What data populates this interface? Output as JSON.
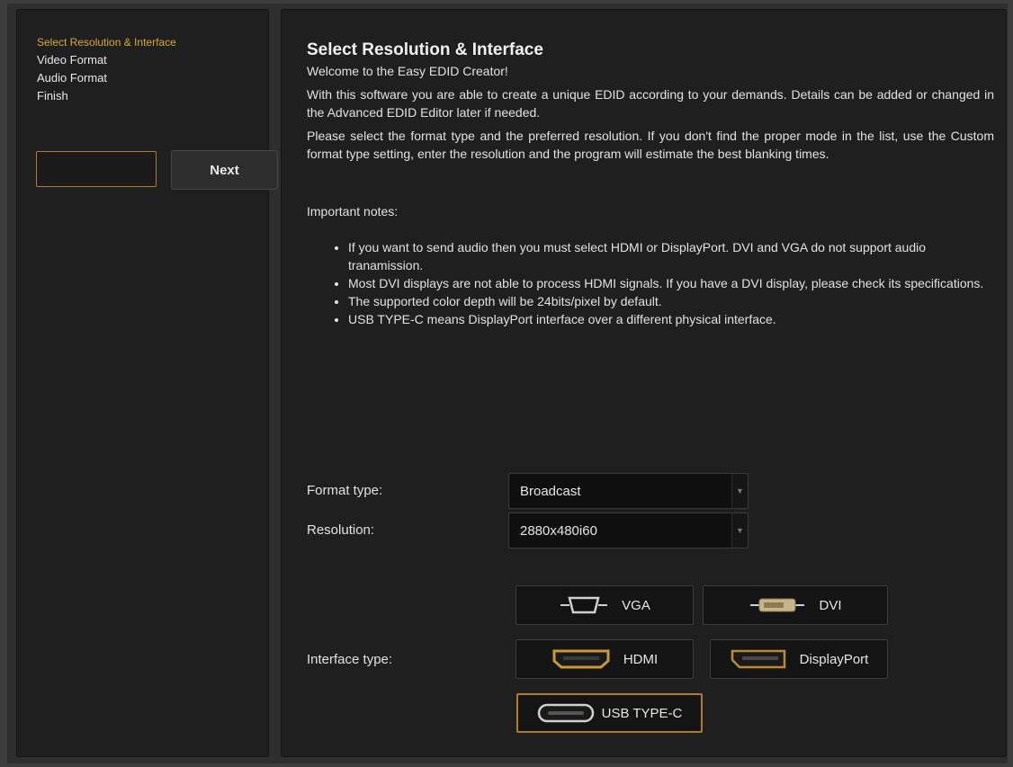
{
  "sidebar": {
    "steps": [
      {
        "label": "Select Resolution & Interface"
      },
      {
        "label": "Video Format"
      },
      {
        "label": "Audio Format"
      },
      {
        "label": "Finish"
      }
    ],
    "next_label": "Next"
  },
  "main": {
    "title": "Select Resolution & Interface",
    "welcome": "Welcome to the Easy EDID Creator!",
    "intro": "With this software you are able to create a unique EDID according to your demands. Details can be added or changed in the Advanced EDID Editor later if needed.",
    "instructions": "Please select the format type and the preferred resolution. If you don't find the proper mode in the list, use the Custom format type setting, enter the resolution and the program will estimate the best blanking times.",
    "notes_label": "Important notes:",
    "notes": [
      "If you want to send audio then you must select HDMI or DisplayPort. DVI and VGA do not support audio tranamission.",
      "Most DVI displays are not able to process HDMI signals. If you have a DVI display, please check its specifications.",
      "The supported color depth will be 24bits/pixel by default.",
      "USB TYPE-C means DisplayPort interface over a different physical interface."
    ]
  },
  "form": {
    "format_type_label": "Format type:",
    "format_type_value": "Broadcast",
    "resolution_label": "Resolution:",
    "resolution_value": "2880x480i60",
    "interface_type_label": "Interface type:"
  },
  "interfaces": {
    "vga": {
      "label": "VGA",
      "icon": "vga-port-icon"
    },
    "dvi": {
      "label": "DVI",
      "icon": "dvi-port-icon"
    },
    "hdmi": {
      "label": "HDMI",
      "icon": "hdmi-port-icon"
    },
    "displayport": {
      "label": "DisplayPort",
      "icon": "displayport-port-icon"
    },
    "usbc": {
      "label": "USB TYPE-C",
      "icon": "usb-c-port-icon",
      "selected": true
    }
  },
  "colors": {
    "accent": "#d7a83a",
    "selected_border": "#b07a30",
    "panel_bg": "#1f1f1f"
  }
}
